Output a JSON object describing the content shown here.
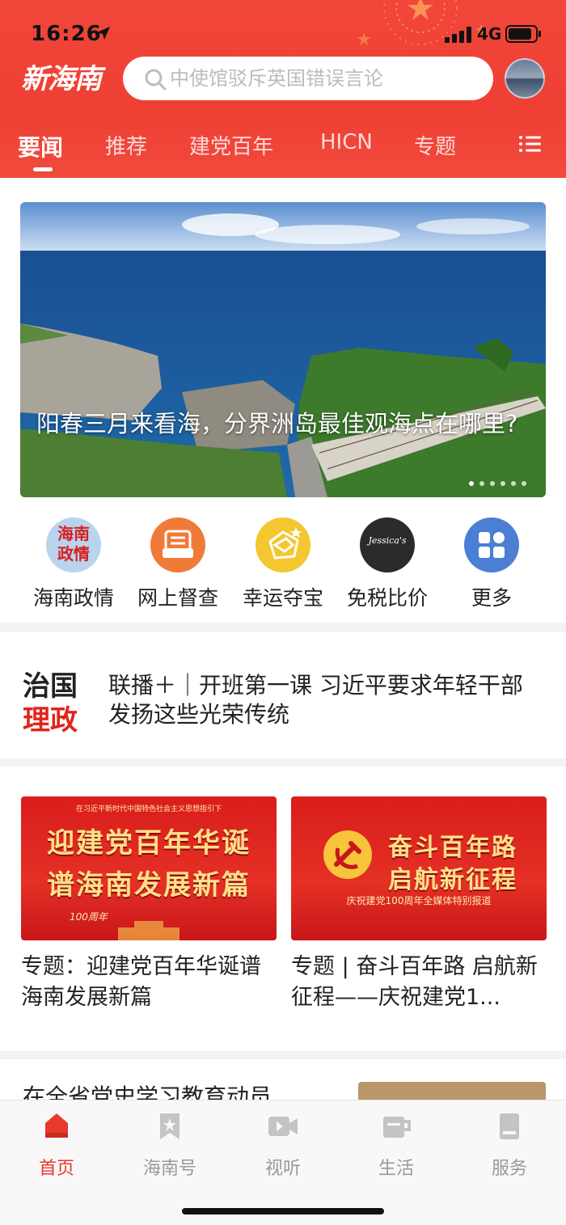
{
  "status_bar": {
    "time": "16:26",
    "network": "4G"
  },
  "header": {
    "logo_text": "新海南",
    "search_placeholder": "中使馆驳斥英国错误言论",
    "tabs": [
      {
        "label": "要闻",
        "active": true
      },
      {
        "label": "推荐",
        "active": false
      },
      {
        "label": "建党百年",
        "active": false
      },
      {
        "label": "HICN",
        "active": false
      },
      {
        "label": "专题",
        "active": false
      }
    ],
    "icons": [
      "location-arrow-icon",
      "signal-icon",
      "battery-icon",
      "search-icon",
      "menu-icon"
    ]
  },
  "banner": {
    "title": "阳春三月来看海，分界洲岛最佳观海点在哪里?",
    "dot_count": 6
  },
  "quick_entries": [
    {
      "label": "海南政情",
      "icon": "hainan-politics-icon",
      "icon_text": "海南政情"
    },
    {
      "label": "网上督查",
      "icon": "online-inspection-icon"
    },
    {
      "label": "幸运夺宝",
      "icon": "lucky-treasure-icon"
    },
    {
      "label": "免税比价",
      "icon": "duty-free-compare-icon",
      "icon_text": "Jessica's"
    },
    {
      "label": "更多",
      "icon": "more-grid-icon"
    }
  ],
  "governance": {
    "logo_line1": "治国",
    "logo_line2": "理政",
    "headline": "联播＋｜开班第一课 习近平要求年轻干部发扬这些光荣传统"
  },
  "specials": [
    {
      "title": "专题：迎建党百年华诞谱海南发展新篇",
      "image_top": "在习近平新时代中国特色社会主义思想指引下",
      "image_line1": "迎建党百年华诞",
      "image_line2": "谱海南发展新篇",
      "image_badge": "100周年"
    },
    {
      "title": "专题 | 奋斗百年路 启航新征程——庆祝建党1...",
      "image_line1": "奋斗百年路",
      "image_line2": "启航新征程",
      "image_sub": "庆祝建党100周年全媒体特别报道"
    }
  ],
  "next_item": {
    "title": "在全省党史学习教育动员"
  },
  "tabbar": [
    {
      "label": "首页",
      "icon": "home-icon",
      "active": true
    },
    {
      "label": "海南号",
      "icon": "bookmark-star-icon",
      "active": false
    },
    {
      "label": "视听",
      "icon": "video-icon",
      "active": false
    },
    {
      "label": "生活",
      "icon": "cup-icon",
      "active": false
    },
    {
      "label": "服务",
      "icon": "service-book-icon",
      "active": false
    }
  ],
  "colors": {
    "brand_red": "#ef3f34",
    "active_tab": "#e8392d",
    "inactive_tab": "#999999",
    "accent_red_text": "#e2231a"
  }
}
